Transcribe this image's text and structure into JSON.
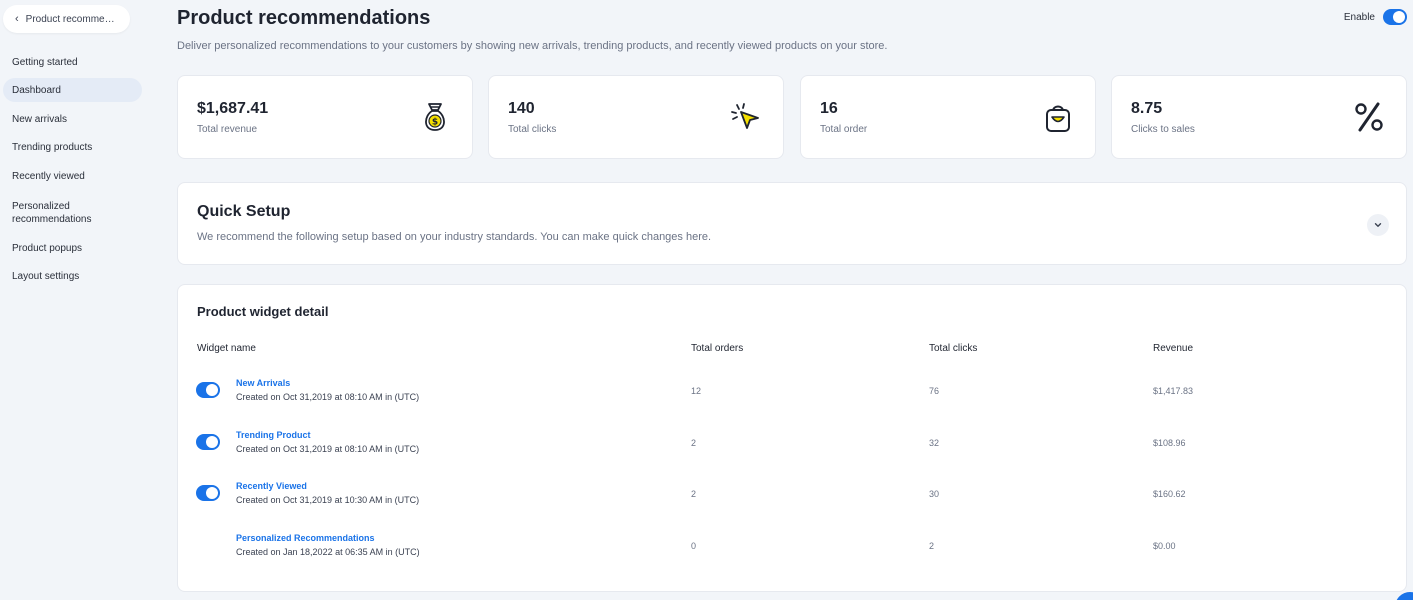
{
  "sidebar": {
    "back_label": "Product recommen...",
    "items": [
      {
        "label": "Getting started",
        "active": false
      },
      {
        "label": "Dashboard",
        "active": true
      },
      {
        "label": "New arrivals",
        "active": false
      },
      {
        "label": "Trending products",
        "active": false
      },
      {
        "label": "Recently viewed",
        "active": false
      },
      {
        "label": "Personalized recommendations",
        "active": false
      },
      {
        "label": "Product popups",
        "active": false
      },
      {
        "label": "Layout settings",
        "active": false
      }
    ]
  },
  "header": {
    "title": "Product recommendations",
    "subtitle": "Deliver personalized recommendations to your customers by showing new arrivals, trending products, and recently viewed products on your store.",
    "enable_label": "Enable",
    "enabled": true
  },
  "stats": [
    {
      "value": "$1,687.41",
      "label": "Total revenue",
      "icon": "money-bag-icon"
    },
    {
      "value": "140",
      "label": "Total clicks",
      "icon": "click-cursor-icon"
    },
    {
      "value": "16",
      "label": "Total order",
      "icon": "shopping-bag-icon"
    },
    {
      "value": "8.75",
      "label": "Clicks to sales",
      "icon": "percent-icon"
    }
  ],
  "quick_setup": {
    "title": "Quick Setup",
    "description": "We recommend the following setup based on your industry standards. You can make quick changes here."
  },
  "widget_detail": {
    "title": "Product widget detail",
    "columns": [
      "Widget name",
      "Total orders",
      "Total clicks",
      "Revenue"
    ],
    "rows": [
      {
        "name": "New Arrivals",
        "created": "Created on Oct 31,2019 at 08:10 AM in (UTC)",
        "orders": "12",
        "clicks": "76",
        "revenue": "$1,417.83",
        "enabled": true
      },
      {
        "name": "Trending Product",
        "created": "Created on Oct 31,2019 at 08:10 AM in (UTC)",
        "orders": "2",
        "clicks": "32",
        "revenue": "$108.96",
        "enabled": true
      },
      {
        "name": "Recently Viewed",
        "created": "Created on Oct 31,2019 at 10:30 AM in (UTC)",
        "orders": "2",
        "clicks": "30",
        "revenue": "$160.62",
        "enabled": true
      },
      {
        "name": "Personalized Recommendations",
        "created": "Created on Jan 18,2022 at 06:35 AM in (UTC)",
        "orders": "0",
        "clicks": "2",
        "revenue": "$0.00",
        "enabled": false
      }
    ]
  },
  "colors": {
    "accent": "#1a73e8",
    "background": "#f2f5f9",
    "icon_yellow": "#f5e000"
  }
}
